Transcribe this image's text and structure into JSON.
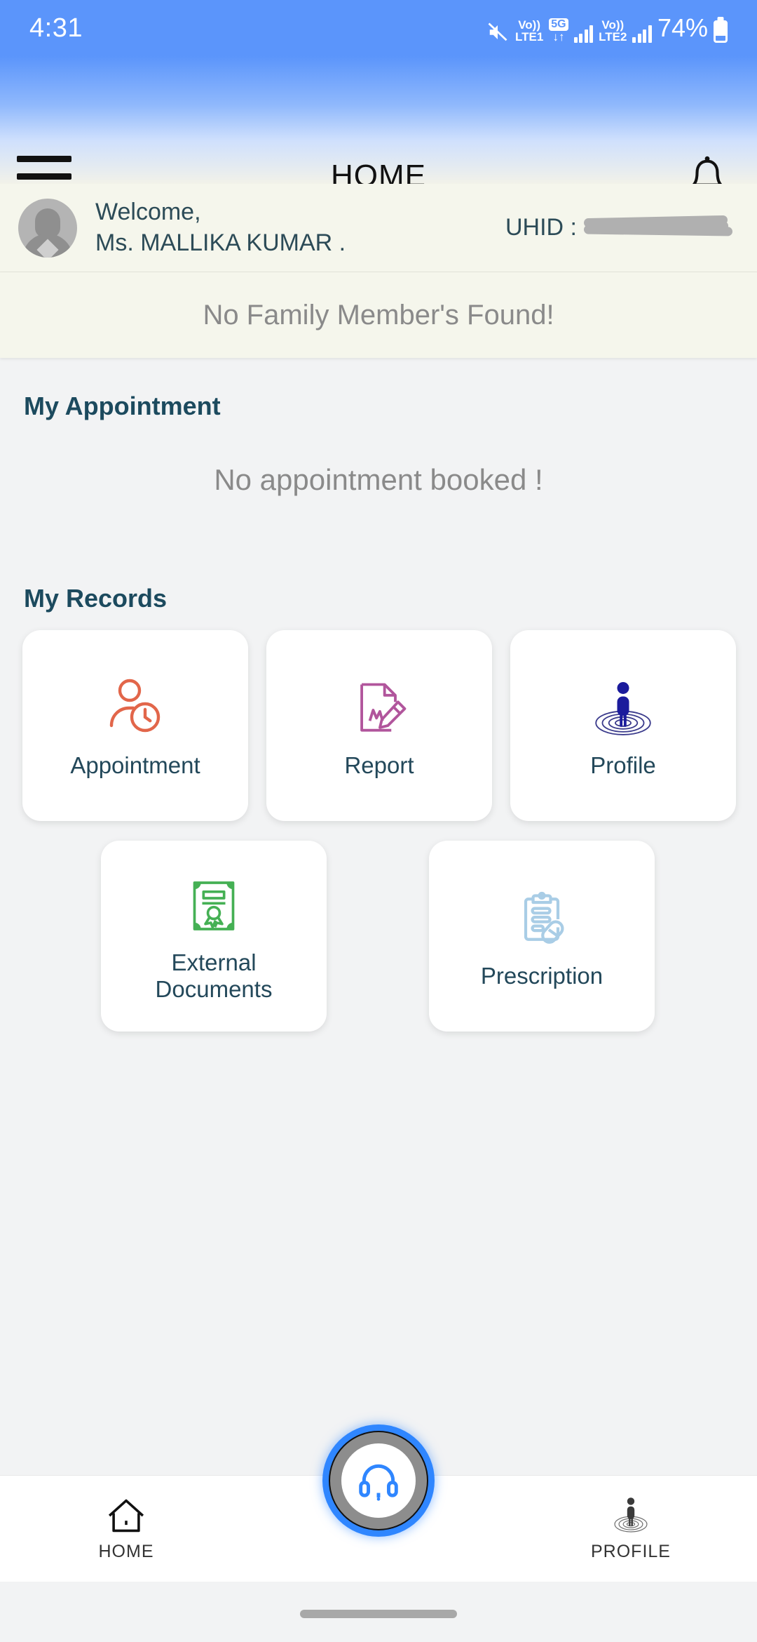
{
  "status_bar": {
    "time": "4:31",
    "mute_icon": "mute-icon",
    "sim1_volte": "Vo))",
    "sim1_label": "LTE1",
    "network_badge": "5G",
    "data_arrows": "↓↑",
    "sim2_volte": "Vo))",
    "sim2_label": "LTE2",
    "battery": "74%"
  },
  "app_bar": {
    "menu_icon": "hamburger-menu-icon",
    "title": "HOME",
    "notification_icon": "bell-icon"
  },
  "welcome": {
    "avatar_icon": "user-avatar-icon",
    "greeting": "Welcome,",
    "name": "Ms. MALLIKA KUMAR .",
    "uhid_label": "UHID :",
    "uhid_value": ""
  },
  "family": {
    "message": "No Family Member's Found!"
  },
  "appointments": {
    "section_title": "My Appointment",
    "empty_message": "No appointment booked !"
  },
  "records": {
    "section_title": "My Records",
    "cards": [
      {
        "label": "Appointment",
        "icon": "appointment-clock-person-icon"
      },
      {
        "label": "Report",
        "icon": "report-document-pencil-icon"
      },
      {
        "label": "Profile",
        "icon": "profile-person-rings-icon"
      },
      {
        "label": "External\nDocuments",
        "icon": "certificate-icon"
      },
      {
        "label": "Prescription",
        "icon": "prescription-clipboard-pills-icon"
      }
    ]
  },
  "bottom_nav": {
    "home_label": "HOME",
    "home_icon": "home-icon",
    "support_icon": "headset-icon",
    "profile_label": "PROFILE",
    "profile_icon": "profile-person-rings-icon"
  },
  "colors": {
    "status_bar_blue": "#5b95fb",
    "heading_teal": "#1c4a5e",
    "card_label": "#23485a",
    "muted_text": "#8a8a8a",
    "cream": "#f5f6ec",
    "page_bg": "#f2f3f4",
    "fab_blue": "#2f86ff",
    "appointment_icon": "#e2664a",
    "report_icon": "#b1559c",
    "profile_icon": "#1b1b9c",
    "external_icon": "#45b054",
    "prescription_icon": "#a9cde6"
  }
}
